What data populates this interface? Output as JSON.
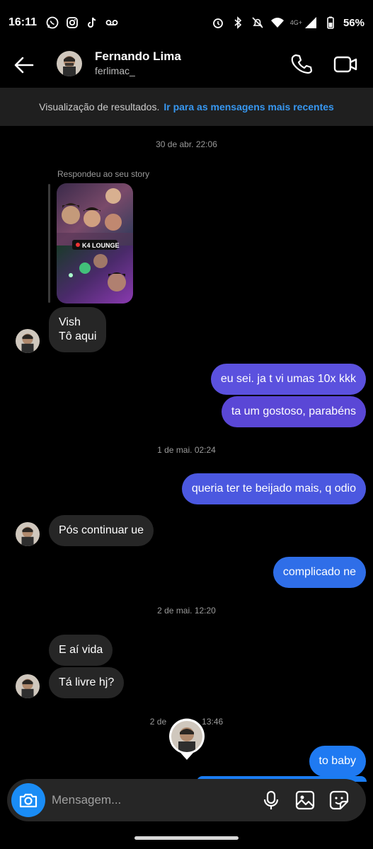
{
  "status_bar": {
    "time": "16:11",
    "battery": "56%",
    "network": "4G+"
  },
  "header": {
    "name": "Fernando Lima",
    "username": "ferlimac_"
  },
  "banner": {
    "text": "Visualização de resultados.",
    "link": "Ir para as mensagens mais recentes"
  },
  "thread": {
    "ts1": "30 de abr. 22:06",
    "reply_label": "Respondeu ao seu story",
    "story_tag": "K4 LOUNGE",
    "in1_line1": "Vish",
    "in1_line2": "Tô aqui",
    "out1": "eu sei. ja t vi umas 10x kkk",
    "out2": "ta um gostoso, parabéns",
    "ts2": "1 de mai. 02:24",
    "out3": "queria ter te beijado mais, q odio",
    "in2": "Pós continuar ue",
    "out4": "complicado ne",
    "ts3": "2 de mai. 12:20",
    "in3": "E aí vida",
    "in4": "Tá livre hj?",
    "ts4_left": "2 de",
    "ts4_right": "13:46",
    "out5": "to baby"
  },
  "composer": {
    "placeholder": "Mensagem..."
  },
  "colors": {
    "incoming": "#262626",
    "outgoing": "#5b51de",
    "camera": "#1a8cf5",
    "link": "#3797f0"
  }
}
